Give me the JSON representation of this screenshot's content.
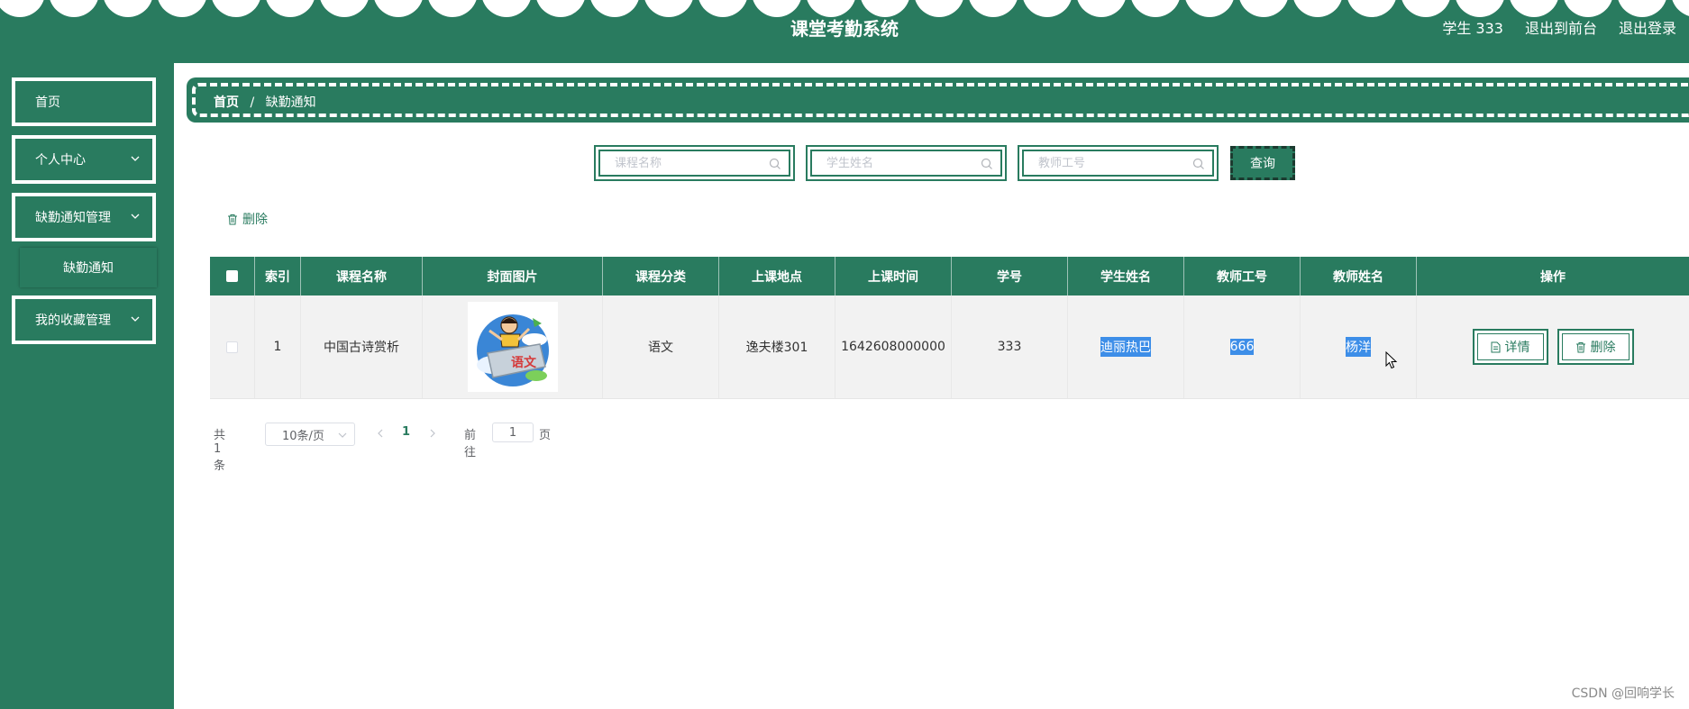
{
  "header": {
    "title": "课堂考勤系统",
    "user_label": "学生 333",
    "to_front_label": "退出到前台",
    "logout_label": "退出登录"
  },
  "sidebar": {
    "items": [
      {
        "label": "首页"
      },
      {
        "label": "个人中心"
      },
      {
        "label": "缺勤通知管理"
      },
      {
        "label": "缺勤通知"
      },
      {
        "label": "我的收藏管理"
      }
    ]
  },
  "breadcrumb": {
    "home": "首页",
    "separator": "/",
    "current": "缺勤通知"
  },
  "search": {
    "course_placeholder": "课程名称",
    "student_placeholder": "学生姓名",
    "teacher_placeholder": "教师工号",
    "query_label": "查询"
  },
  "actions": {
    "delete_label": "删除"
  },
  "table": {
    "headers": [
      "索引",
      "课程名称",
      "封面图片",
      "课程分类",
      "上课地点",
      "上课时间",
      "学号",
      "学生姓名",
      "教师工号",
      "教师姓名",
      "操作"
    ],
    "rows": [
      {
        "index": "1",
        "course_name": "中国古诗赏析",
        "category": "语文",
        "location": "逸夫楼301",
        "time": "1642608000000",
        "student_id": "333",
        "student_name": "迪丽热巴",
        "teacher_id": "666",
        "teacher_name": "杨洋",
        "detail_label": "详情",
        "delete_label": "删除"
      }
    ]
  },
  "pagination": {
    "total_label": "共 1 条",
    "page_size": "10条/页",
    "current_page": "1",
    "goto_prefix": "前往",
    "goto_value": "1",
    "goto_suffix": "页"
  },
  "watermark": "CSDN @回响学长",
  "colors": {
    "primary": "#297b5f",
    "selection": "#3d8ee8"
  }
}
